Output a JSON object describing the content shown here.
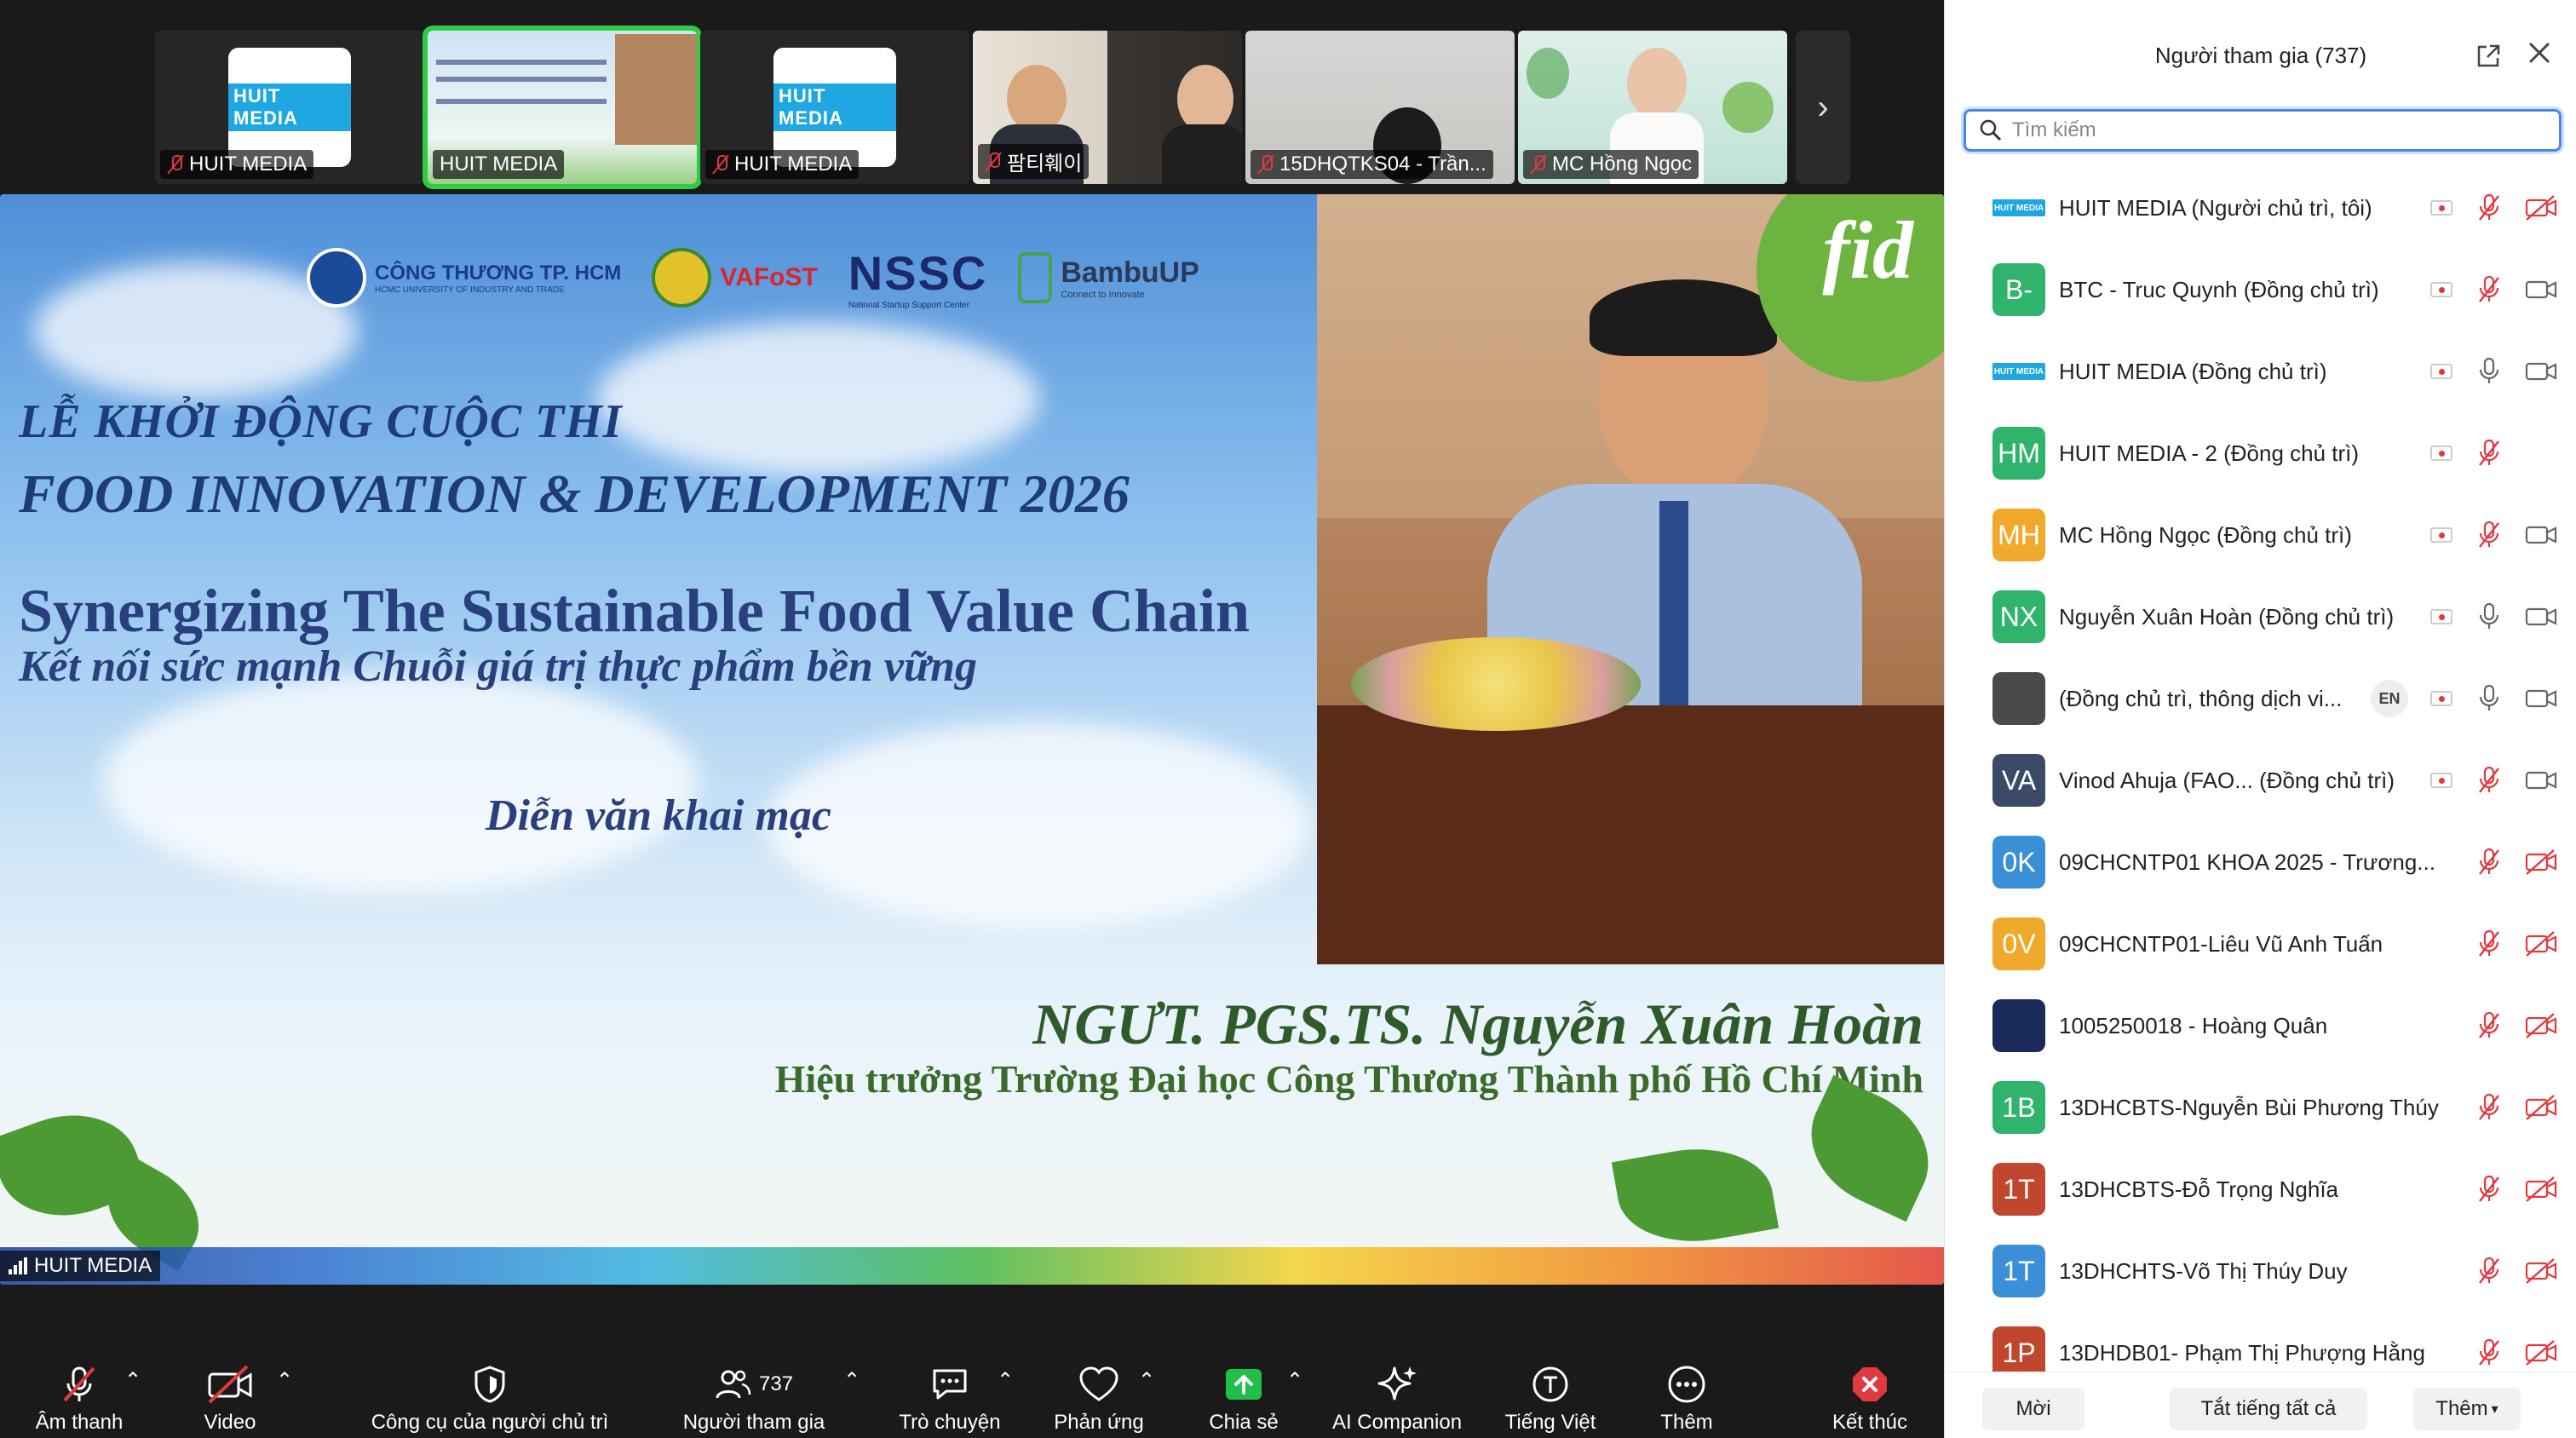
{
  "strip": {
    "tiles": [
      {
        "name": "HUIT MEDIA",
        "type": "logo",
        "logo_top": "HUIT MEDIA"
      },
      {
        "name": "HUIT MEDIA",
        "type": "slide"
      },
      {
        "name": "HUIT MEDIA",
        "type": "logo",
        "logo_top": "HUIT MEDIA"
      },
      {
        "name": "팜티훼이",
        "type": "photo"
      },
      {
        "name": "15DHQTKS04 - Trần...",
        "type": "photo"
      },
      {
        "name": "MC Hồng Ngọc",
        "type": "photo"
      }
    ],
    "next_label": "›"
  },
  "main": {
    "logos": {
      "uni_name": "CÔNG THƯƠNG TP. HCM",
      "uni_sub": "HCMC UNIVERSITY OF INDUSTRY AND TRADE",
      "vafost": "VAFoST",
      "nssc": "NSSC",
      "nssc_sub": "National Startup Support Center",
      "bambu": "BambuUP",
      "bambu_sub": "Connect to Innovate"
    },
    "title_line1": "LỄ KHỞI ĐỘNG CUỘC THI",
    "title_line2": "FOOD INNOVATION & DEVELOPMENT 2026",
    "title_line3": "Synergizing The Sustainable Food Value Chain",
    "title_line4": "Kết nối sức mạnh Chuỗi giá trị thực phẩm bền vững",
    "title_line5": "Diễn văn khai mạc",
    "speaker_name": "NGƯT. PGS.TS. Nguyễn Xuân Hoàn",
    "speaker_title": "Hiệu trưởng Trường Đại học Công Thương Thành phố Hồ Chí Minh",
    "fid_logo": "fid",
    "label": "HUIT MEDIA"
  },
  "toolbar": {
    "audio": "Âm thanh",
    "video": "Video",
    "host_tools": "Công cụ của người chủ trì",
    "participants": "Người tham gia",
    "participants_count": "737",
    "chat": "Trò chuyện",
    "reactions": "Phản ứng",
    "share": "Chia sẻ",
    "ai_companion": "AI Companion",
    "language": "Tiếng Việt",
    "more": "Thêm",
    "end": "Kết thúc"
  },
  "panel": {
    "title": "Người tham gia (737)",
    "search_placeholder": "Tìm kiếm",
    "participants": [
      {
        "name": "HUIT MEDIA (Người chủ trì, tôi)",
        "avatar": "HUIT MEDIA",
        "avatar_type": "mini",
        "color": "#1ea7e1",
        "rec": true,
        "mic": "off",
        "cam": "off"
      },
      {
        "name": "BTC - Truc Quynh (Đồng chủ trì)",
        "avatar": "B-",
        "color": "#2fb36d",
        "rec": true,
        "mic": "off",
        "cam": "on"
      },
      {
        "name": "HUIT MEDIA (Đồng chủ trì)",
        "avatar": "HUIT MEDIA",
        "avatar_type": "mini",
        "color": "#1ea7e1",
        "rec": true,
        "mic": "on",
        "cam": "on"
      },
      {
        "name": "HUIT MEDIA - 2 (Đồng chủ trì)",
        "avatar": "HM",
        "color": "#2fb36d",
        "rec": true,
        "mic": "off",
        "cam": "none"
      },
      {
        "name": "MC Hồng Ngọc (Đồng chủ trì)",
        "avatar": "MH",
        "color": "#f0a92a",
        "rec": true,
        "mic": "off",
        "cam": "on"
      },
      {
        "name": "Nguyễn Xuân Hoàn (Đồng chủ trì)",
        "avatar": "NX",
        "color": "#2fb36d",
        "rec": true,
        "mic": "on",
        "cam": "on"
      },
      {
        "name": "(Đồng chủ trì, thông dịch vi...",
        "avatar": "",
        "color": "#4a4a4a",
        "badge": "EN",
        "rec": true,
        "mic": "on",
        "cam": "on"
      },
      {
        "name": "Vinod Ahuja (FAO...   (Đồng chủ trì)",
        "avatar": "VA",
        "color": "#3b4a66",
        "rec": true,
        "mic": "off",
        "cam": "on"
      },
      {
        "name": "09CHCNTP01 KHOA 2025 - Trương...",
        "avatar": "0K",
        "color": "#3a8fd6",
        "rec": false,
        "mic": "off",
        "cam": "off"
      },
      {
        "name": "09CHCNTP01-Liêu Vũ Anh Tuấn",
        "avatar": "0V",
        "color": "#f0a92a",
        "rec": false,
        "mic": "off",
        "cam": "off"
      },
      {
        "name": "1005250018 - Hoàng Quân",
        "avatar": "",
        "color": "#1a2a5a",
        "rec": false,
        "mic": "off",
        "cam": "off"
      },
      {
        "name": "13DHCBTS-Nguyễn Bùi Phương Thúy",
        "avatar": "1B",
        "color": "#2fb36d",
        "rec": false,
        "mic": "off",
        "cam": "off"
      },
      {
        "name": "13DHCBTS-Đỗ Trọng Nghĩa",
        "avatar": "1T",
        "color": "#c0462e",
        "rec": false,
        "mic": "off",
        "cam": "off"
      },
      {
        "name": "13DHCHTS-Võ Thị Thúy Duy",
        "avatar": "1T",
        "color": "#3a8fd6",
        "rec": false,
        "mic": "off",
        "cam": "off"
      },
      {
        "name": "13DHDB01- Phạm Thị Phượng Hằng",
        "avatar": "1P",
        "color": "#c0462e",
        "rec": false,
        "mic": "off",
        "cam": "off"
      }
    ],
    "footer": {
      "invite": "Mời",
      "mute_all": "Tắt tiếng tất cả",
      "more": "Thêm"
    }
  }
}
